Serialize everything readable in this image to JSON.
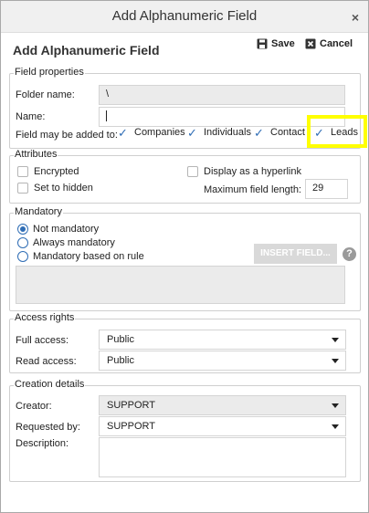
{
  "window": {
    "title": "Add Alphanumeric Field",
    "close_glyph": "×"
  },
  "header": {
    "title": "Add Alphanumeric Field",
    "save_label": "Save",
    "cancel_label": "Cancel"
  },
  "field_properties": {
    "legend": "Field properties",
    "folder_label": "Folder name:",
    "folder_value": "\\",
    "name_label": "Name:",
    "name_value": "",
    "added_to_label": "Field may be added to:",
    "targets": [
      {
        "label": "Companies",
        "checked": true
      },
      {
        "label": "Individuals",
        "checked": true
      },
      {
        "label": "Contact",
        "checked": true
      },
      {
        "label": "Leads",
        "checked": true
      }
    ]
  },
  "attributes": {
    "legend": "Attributes",
    "encrypted_label": "Encrypted",
    "hidden_label": "Set to hidden",
    "hyperlink_label": "Display as a hyperlink",
    "max_length_label": "Maximum field length:",
    "max_length_value": "29"
  },
  "mandatory": {
    "legend": "Mandatory",
    "options": [
      {
        "label": "Not mandatory",
        "selected": true
      },
      {
        "label": "Always mandatory",
        "selected": false
      },
      {
        "label": "Mandatory based on rule",
        "selected": false
      }
    ],
    "insert_label": "INSERT FIELD...",
    "help_glyph": "?"
  },
  "access": {
    "legend": "Access rights",
    "full_label": "Full access:",
    "full_value": "Public",
    "read_label": "Read access:",
    "read_value": "Public"
  },
  "creation": {
    "legend": "Creation details",
    "creator_label": "Creator:",
    "creator_value": "SUPPORT",
    "requested_label": "Requested by:",
    "requested_value": "SUPPORT",
    "description_label": "Description:"
  },
  "colors": {
    "accent": "#2f6db5",
    "highlight": "#ffff00",
    "readonly_bg": "#ebebeb"
  }
}
